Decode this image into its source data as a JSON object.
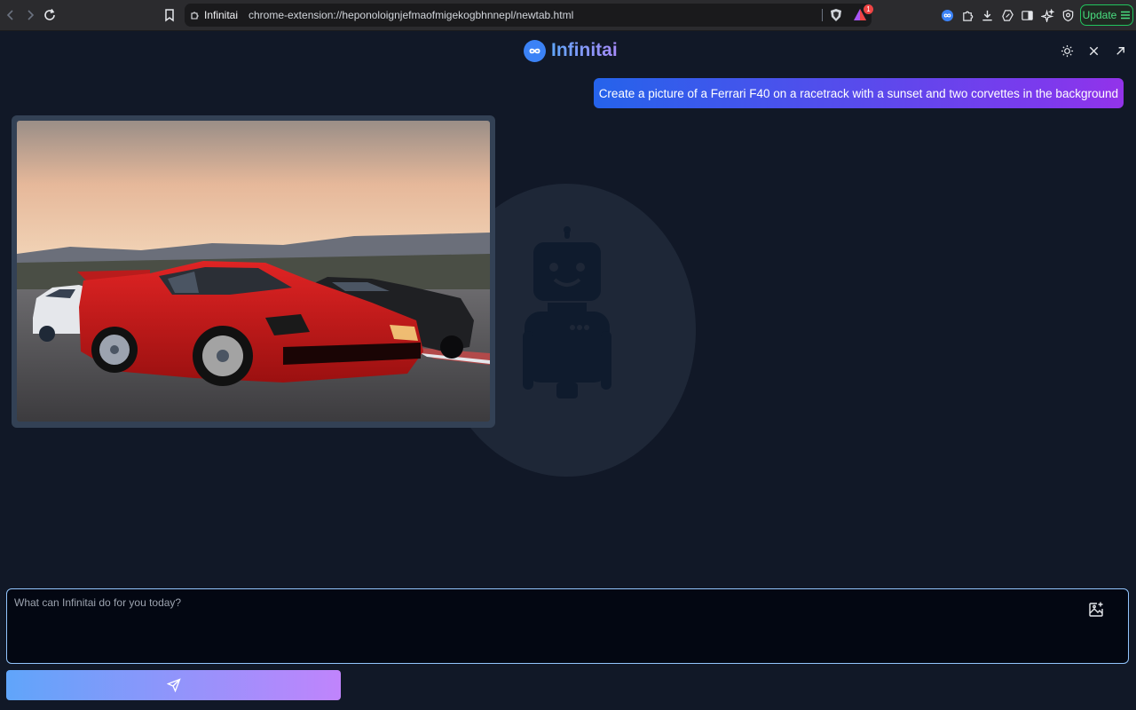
{
  "browser": {
    "tab_title": "Infinitai",
    "url": "chrome-extension://heponoloignjefmaofmigekogbhnnepl/newtab.html",
    "rewards_badge_count": "1",
    "update_label": "Update",
    "icons": [
      "back-icon",
      "forward-icon",
      "reload-icon",
      "bookmark-icon",
      "puzzle-icon",
      "brave-shield-icon",
      "brave-rewards-icon",
      "infinitai-extension-icon",
      "extensions-icon",
      "download-icon",
      "leo-icon",
      "sidebar-icon",
      "ai-sparkle-icon",
      "vpn-icon",
      "menu-icon"
    ]
  },
  "app": {
    "name": "Infinitai",
    "theme_toggle_icon": "sun-icon",
    "close_icon": "close-icon",
    "open_external_icon": "arrow-up-right-icon"
  },
  "chat": {
    "user_message": "Create a picture of a Ferrari F40 on a racetrack with a sunset and two corvettes in the background",
    "generated_image_subject": "red Ferrari F40 on racetrack at sunset with white and black corvettes behind"
  },
  "composer": {
    "placeholder": "What can Infinitai do for you today?",
    "value": "",
    "image_button_icon": "image-plus-icon",
    "send_icon": "send-icon"
  },
  "colors": {
    "background": "#111827",
    "accent_blue": "#3b82f6",
    "accent_purple": "#a78bfa",
    "update_green": "#22c55e"
  }
}
